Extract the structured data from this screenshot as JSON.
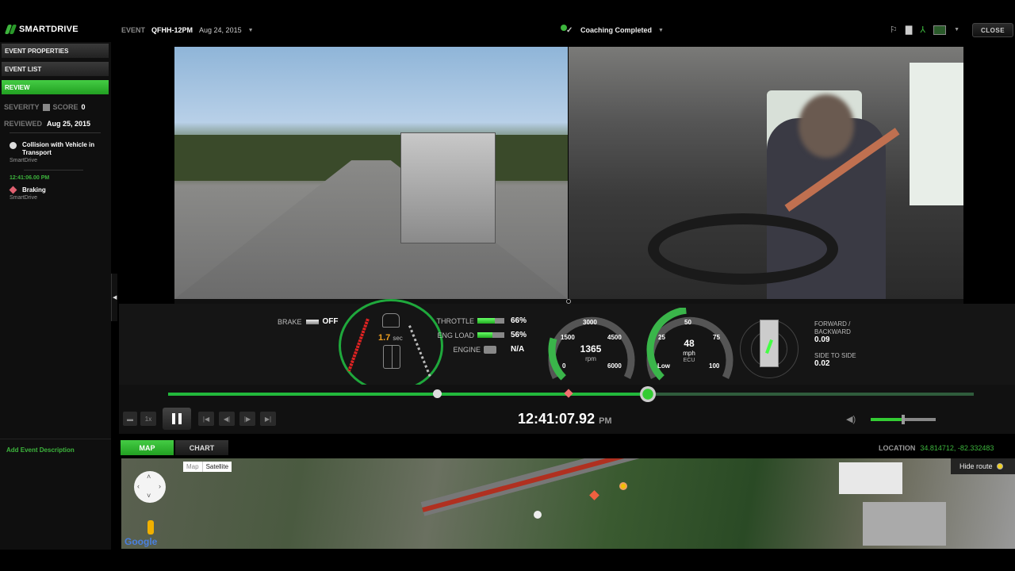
{
  "header": {
    "brand": "SMARTDRIVE",
    "event_label": "EVENT",
    "event_id": "QFHH-12PM",
    "event_date": "Aug 24, 2015",
    "coaching_status": "Coaching Completed",
    "close_label": "CLOSE",
    "tool_icons": [
      "flag-icon",
      "document-icon",
      "pdf-icon",
      "video-export-icon"
    ]
  },
  "sidebar": {
    "buttons": [
      {
        "label": "EVENT PROPERTIES",
        "active": false
      },
      {
        "label": "EVENT LIST",
        "active": false
      },
      {
        "label": "REVIEW",
        "active": true
      }
    ],
    "severity_label": "SEVERITY",
    "score_label": "SCORE",
    "score_value": "0",
    "reviewed_label": "REVIEWED",
    "reviewed_date": "Aug 25, 2015",
    "events": [
      {
        "title": "Collision with Vehicle in Transport",
        "source": "SmartDrive",
        "icon": "circle"
      },
      {
        "time": "12:41:06.00 PM",
        "title": "Braking",
        "source": "SmartDrive",
        "icon": "diamond"
      }
    ],
    "add_description": "Add Event Description"
  },
  "telemetry": {
    "brake_label": "BRAKE",
    "brake_value": "OFF",
    "following_distance": "1.7",
    "following_unit": "sec",
    "throttle_label": "THROTTLE",
    "throttle_value": "66%",
    "throttle_fraction": 0.66,
    "eng_load_label": "ENG LOAD",
    "eng_load_value": "56%",
    "eng_load_fraction": 0.56,
    "engine_label": "ENGINE",
    "engine_value": "N/A",
    "rpm": {
      "value": "1365",
      "unit": "rpm",
      "ticks": [
        "0",
        "1500",
        "3000",
        "4500",
        "6000"
      ],
      "max": 6000
    },
    "speed": {
      "value": "48",
      "unit": "mph",
      "source": "ECU",
      "ticks": [
        "Low",
        "25",
        "50",
        "75",
        "100"
      ],
      "max": 100
    },
    "forward_backward_label": "FORWARD / BACKWARD",
    "forward_backward_value": "0.09",
    "side_to_side_label": "SIDE TO SIDE",
    "side_to_side_value": "0.02"
  },
  "timeline": {
    "playhead_fraction": 0.595,
    "markers": [
      {
        "type": "circle",
        "fraction": 0.334
      },
      {
        "type": "diamond",
        "fraction": 0.497
      }
    ]
  },
  "controls": {
    "speed_label": "1x",
    "clock": "12:41:07.92",
    "ampm": "PM",
    "volume_fraction": 0.5
  },
  "map_panel": {
    "tabs": [
      {
        "label": "MAP",
        "active": true
      },
      {
        "label": "CHART",
        "active": false
      }
    ],
    "location_label": "LOCATION",
    "location_value": "34.814712, -82.332483",
    "map_type_options": [
      "Map",
      "Satellite"
    ],
    "map_type_selected": "Satellite",
    "hide_route_label": "Hide route",
    "google_label": "Google"
  }
}
